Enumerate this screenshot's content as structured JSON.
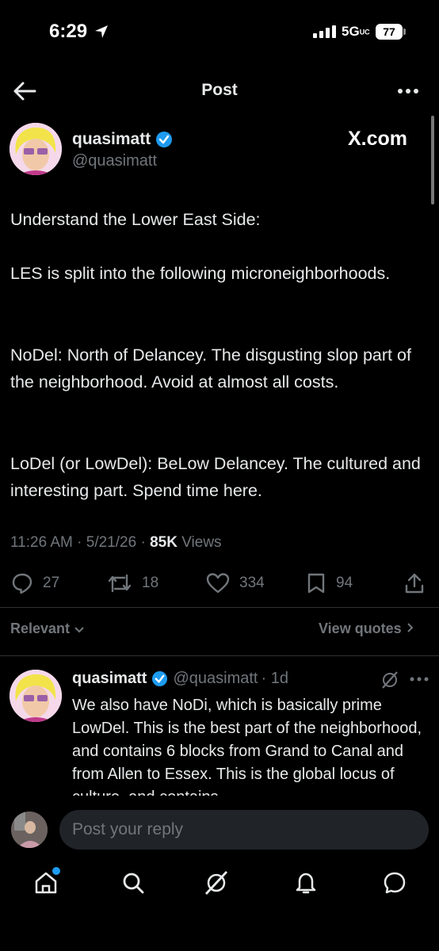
{
  "status_bar": {
    "time": "6:29",
    "network": "5G",
    "network_sub": "UC",
    "battery": "77"
  },
  "nav": {
    "title": "Post"
  },
  "post": {
    "author_name": "quasimatt",
    "author_handle": "@quasimatt",
    "badge": "X.com",
    "paragraphs": [
      "Understand the Lower East Side:",
      "LES is split into the following microneighborhoods.",
      "NoDel: North of Delancey. The disgusting slop part of the neighborhood. Avoid at almost all costs.",
      "LoDel (or LowDel): BeLow Delancey. The cultured and interesting part. Spend time here."
    ],
    "time": "11:26 AM",
    "date": "5/21/26",
    "views_count": "85K",
    "views_label": "Views",
    "replies": "27",
    "reposts": "18",
    "likes": "334",
    "bookmarks": "94"
  },
  "sort": {
    "label": "Relevant",
    "view_quotes": "View quotes"
  },
  "reply": {
    "author_name": "quasimatt",
    "author_handle": "@quasimatt",
    "age": "· 1d",
    "text": "We also have NoDi, which is basically prime LowDel. This is the best part of the neighborhood, and contains 6 blocks from Grand to Canal and from Allen to Essex. This is the global locus of culture, and contains"
  },
  "compose": {
    "placeholder": "Post your reply"
  },
  "colors": {
    "background": "#000000",
    "text": "#e7e9ea",
    "muted": "#71767b",
    "verified": "#1d9bf0",
    "divider": "#2f3336"
  }
}
